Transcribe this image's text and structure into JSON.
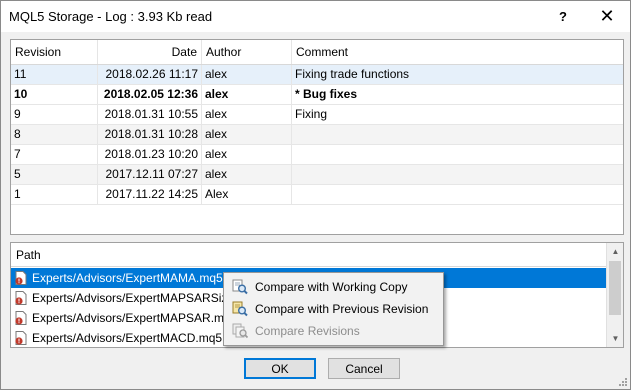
{
  "window": {
    "title": "MQL5 Storage - Log : 3.93 Kb read",
    "help_label": "?",
    "close_label": "✕"
  },
  "log_table": {
    "headers": [
      "Revision",
      "Date",
      "Author",
      "Comment"
    ],
    "rows": [
      {
        "revision": "11",
        "date": "2018.02.26 11:17",
        "author": "alex",
        "comment": "Fixing trade functions"
      },
      {
        "revision": "10",
        "date": "2018.02.05 12:36",
        "author": "alex",
        "comment": "* Bug fixes"
      },
      {
        "revision": "9",
        "date": "2018.01.31 10:55",
        "author": "alex",
        "comment": "Fixing"
      },
      {
        "revision": "8",
        "date": "2018.01.31 10:28",
        "author": "alex",
        "comment": ""
      },
      {
        "revision": "7",
        "date": "2018.01.23 10:20",
        "author": "alex",
        "comment": ""
      },
      {
        "revision": "5",
        "date": "2017.12.11 07:27",
        "author": "alex",
        "comment": ""
      },
      {
        "revision": "1",
        "date": "2017.11.22 14:25",
        "author": "Alex",
        "comment": ""
      }
    ]
  },
  "paths": {
    "header": "Path",
    "items": [
      "Experts/Advisors/ExpertMAMA.mq5",
      "Experts/Advisors/ExpertMAPSARSizeOp",
      "Experts/Advisors/ExpertMAPSAR.mq5",
      "Experts/Advisors/ExpertMACD.mq5"
    ]
  },
  "context_menu": {
    "items": [
      {
        "label": "Compare with Working Copy",
        "icon": "magnifier-compare-icon",
        "enabled": true
      },
      {
        "label": "Compare with Previous Revision",
        "icon": "magnifier-compare-previous-icon",
        "enabled": true
      },
      {
        "label": "Compare Revisions",
        "icon": "compare-revisions-icon",
        "enabled": false
      }
    ]
  },
  "buttons": {
    "ok": "OK",
    "cancel": "Cancel"
  },
  "colors": {
    "selection": "#0078d7",
    "row_highlight": "#e6f0fa",
    "file_icon_error": "#c0392b"
  }
}
